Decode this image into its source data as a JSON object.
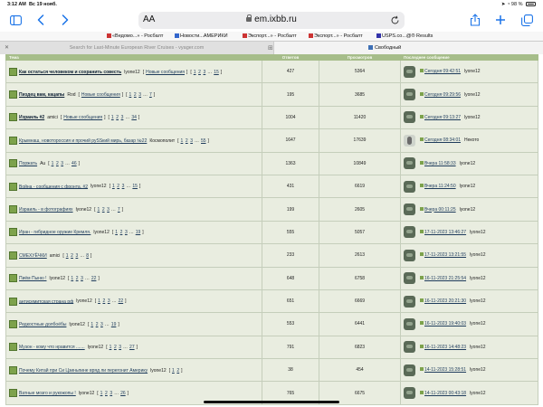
{
  "status_bar": {
    "time": "3:12 AM",
    "date": "Вс 19 нояб.",
    "battery": "98 %"
  },
  "browser": {
    "text_size_label": "AA",
    "url": "em.ixbb.ru",
    "favorites": [
      {
        "label": "«Ведомо...» - Росбалт"
      },
      {
        "label": "Новости...АМЕРИКИ"
      },
      {
        "label": "Экспорт...» - Росбалт"
      },
      {
        "label": "Экспорт...» - Росбалт"
      },
      {
        "label": "USPS.co...@® Results"
      }
    ],
    "tabs": [
      {
        "label": "Search for Last-Minute European River Cruises - vyager.com"
      },
      {
        "label": "Свободный"
      }
    ]
  },
  "forum": {
    "headers": {
      "topic": "Тема",
      "replies": "Ответов",
      "views": "Просмотров",
      "last_post": "Последнее сообщение"
    },
    "new_posts_label": "Новые сообщения",
    "topics": [
      {
        "title": "Как остаться человеком и сохранить совесть",
        "author": "lyone12",
        "new_link": true,
        "pages": [
          "1",
          "2",
          "3",
          "15"
        ],
        "replies": "427",
        "views": "5364",
        "last_time": "Сегодня 09:42:51",
        "last_author": "lyone12",
        "bold": true,
        "avatar": "default"
      },
      {
        "title": "Пиздец вам, кацапы",
        "author": "Rod",
        "new_link": true,
        "pages": [
          "1",
          "2",
          "3",
          "7"
        ],
        "replies": "195",
        "views": "3685",
        "last_time": "Сегодня 09:29:56",
        "last_author": "lyone12",
        "bold": true,
        "avatar": "default"
      },
      {
        "title": "Израиль #2",
        "author": "amici",
        "new_link": true,
        "pages": [
          "1",
          "2",
          "3",
          "34"
        ],
        "replies": "1004",
        "views": "11420",
        "last_time": "Сегодня 09:13:27",
        "last_author": "lyone12",
        "bold": true,
        "avatar": "default"
      },
      {
        "title": "Крымнаш, новотороссия и прочий руSSкий мирь, базар №22",
        "author": "Космополит",
        "new_link": false,
        "pages": [
          "1",
          "2",
          "3",
          "55"
        ],
        "replies": "1647",
        "views": "17639",
        "last_time": "Сегодня 08:34:01",
        "last_author": "Некото",
        "bold": false,
        "avatar": "special"
      },
      {
        "title": "Поржать",
        "author": "Au",
        "new_link": false,
        "pages": [
          "1",
          "2",
          "3",
          "46"
        ],
        "replies": "1363",
        "views": "10849",
        "last_time": "Вчера 11:58:33",
        "last_author": "lyone12",
        "bold": false,
        "avatar": "default"
      },
      {
        "title": "Война - сообщения с фронта. #2",
        "author": "lyone12",
        "new_link": false,
        "pages": [
          "1",
          "2",
          "3",
          "15"
        ],
        "replies": "431",
        "views": "6619",
        "last_time": "Вчера 11:24:50",
        "last_author": "lyone12",
        "bold": false,
        "avatar": "default"
      },
      {
        "title": "Израиль - в фотографиях",
        "author": "lyone12",
        "new_link": false,
        "pages": [
          "1",
          "2",
          "3",
          "7"
        ],
        "replies": "199",
        "views": "2605",
        "last_time": "Вчера 00:11:25",
        "last_author": "lyone12",
        "bold": false,
        "avatar": "default"
      },
      {
        "title": "Иран - гибридное оружие Кремля.",
        "author": "lyone12",
        "new_link": false,
        "pages": [
          "1",
          "2",
          "3",
          "19"
        ],
        "replies": "555",
        "views": "5057",
        "last_time": "17-11-2023 13:46:27",
        "last_author": "lyone12",
        "bold": false,
        "avatar": "default"
      },
      {
        "title": "СМЕХУЁЧКИ",
        "author": "amici",
        "new_link": false,
        "pages": [
          "1",
          "2",
          "3",
          "8"
        ],
        "replies": "233",
        "views": "2613",
        "last_time": "17-11-2023 13:21:55",
        "last_author": "lyone12",
        "bold": false,
        "avatar": "default"
      },
      {
        "title": "Пиём Пыню !",
        "author": "lyone12",
        "new_link": false,
        "pages": [
          "1",
          "2",
          "3",
          "22"
        ],
        "replies": "648",
        "views": "6758",
        "last_time": "16-11-2023 21:25:54",
        "last_author": "lyone12",
        "bold": false,
        "avatar": "default"
      },
      {
        "title": "антисемитская страна рф",
        "author": "lyone12",
        "new_link": false,
        "pages": [
          "1",
          "2",
          "3",
          "22"
        ],
        "replies": "651",
        "views": "6669",
        "last_time": "16-11-2023 20:21:30",
        "last_author": "lyone12",
        "bold": false,
        "avatar": "default"
      },
      {
        "title": "Редкостные долбоёбы",
        "author": "lyone12",
        "new_link": false,
        "pages": [
          "1",
          "2",
          "3",
          "19"
        ],
        "replies": "553",
        "views": "6441",
        "last_time": "16-11-2023 19:40:03",
        "last_author": "lyone12",
        "bold": false,
        "avatar": "default"
      },
      {
        "title": "Музон - кому что нравится .......",
        "author": "lyone12",
        "new_link": false,
        "pages": [
          "1",
          "2",
          "3",
          "27"
        ],
        "replies": "791",
        "views": "6823",
        "last_time": "16-11-2023 14:48:23",
        "last_author": "lyone12",
        "bold": false,
        "avatar": "default"
      },
      {
        "title": "Почему Китай при Си Цзиньпине вряд ли перегонит Америку",
        "author": "lyone12",
        "new_link": false,
        "pages": [
          "1",
          "2"
        ],
        "replies": "38",
        "views": "454",
        "last_time": "14-11-2023 15:28:51",
        "last_author": "lyone12",
        "bold": false,
        "avatar": "default"
      },
      {
        "title": "Ватные мозго и рукожопы !",
        "author": "lyone12",
        "new_link": false,
        "pages": [
          "1",
          "2",
          "3",
          "26"
        ],
        "replies": "765",
        "views": "6675",
        "last_time": "14-11-2023 00:43:18",
        "last_author": "lyone12",
        "bold": false,
        "avatar": "default"
      }
    ]
  },
  "colors": {
    "header_bg": "#a6bd8a",
    "row_bg": "#e9ede0",
    "link": "#1f3c5c",
    "topic_icon": "#7da24c",
    "browser_accent": "#1a73e8"
  }
}
